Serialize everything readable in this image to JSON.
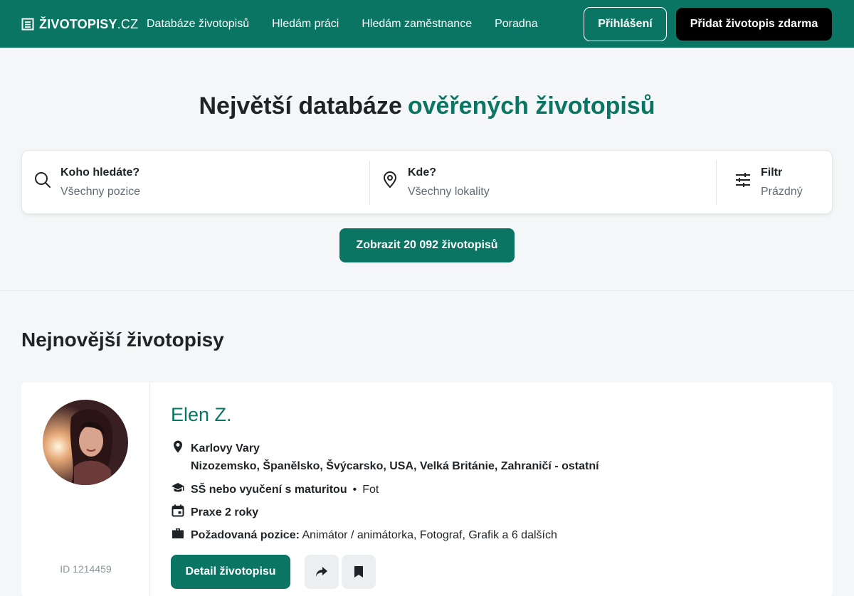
{
  "header": {
    "logo_bold": "ŽIVOTOPISY",
    "logo_light": ".CZ",
    "nav": [
      {
        "label": "Databáze životopisů"
      },
      {
        "label": "Hledám práci"
      },
      {
        "label": "Hledám zaměstnance"
      },
      {
        "label": "Poradna"
      }
    ],
    "login_label": "Přihlášení",
    "add_label": "Přidat životopis zdarma"
  },
  "hero": {
    "title_main": "Největší databáze",
    "title_accent": "ověřených životopisů"
  },
  "search": {
    "who": {
      "label": "Koho hledáte?",
      "placeholder": "Všechny pozice"
    },
    "where": {
      "label": "Kde?",
      "placeholder": "Všechny lokality"
    },
    "filter": {
      "label": "Filtr",
      "value": "Prázdný"
    },
    "submit_label": "Zobrazit 20 092 životopisů"
  },
  "latest": {
    "title": "Nejnovější životopisy",
    "card": {
      "name": "Elen Z.",
      "id_text": "ID 1214459",
      "location": "Karlovy Vary",
      "countries": "Nizozemsko, Španělsko, Švýcarsko, USA, Velká Británie, Zahraničí - ostatní",
      "education": "SŠ nebo vyučení s maturitou",
      "education_field": "Fot",
      "experience": "Praxe 2 roky",
      "position_label": "Požadovaná pozice:",
      "positions": "Animátor / animátorka, Fotograf, Grafik a 6 dalších",
      "detail_label": "Detail životopisu"
    }
  },
  "colors": {
    "brand": "#0b7564",
    "dark": "#000000",
    "bg": "#f4f6f7"
  },
  "icons": [
    "document-icon",
    "search-icon",
    "location-pin-icon",
    "filter-sliders-icon",
    "location-icon",
    "graduation-cap-icon",
    "calendar-icon",
    "briefcase-icon",
    "share-icon",
    "bookmark-icon"
  ]
}
